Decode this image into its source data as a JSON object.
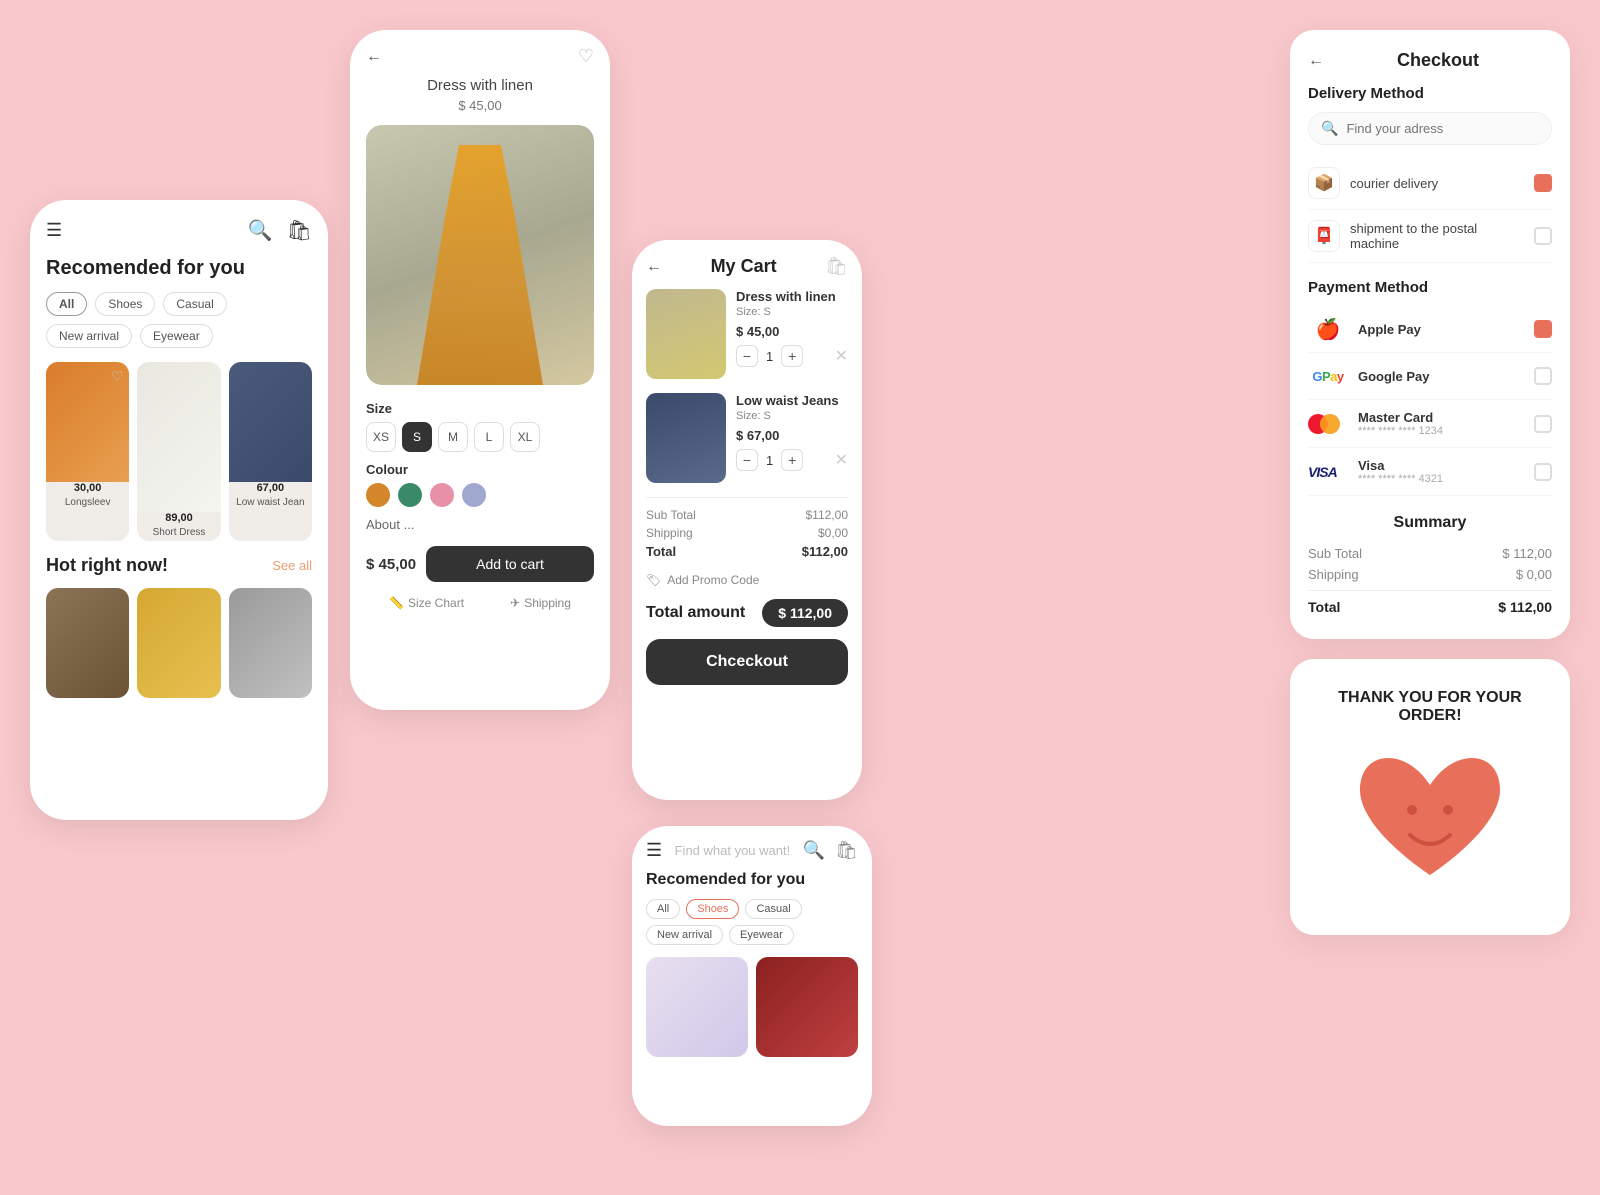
{
  "phone1": {
    "title": "Recomended for you",
    "filters": [
      "All",
      "Shoes",
      "Casual",
      "New arrival",
      "Eyewear"
    ],
    "active_filter": "All",
    "products": [
      {
        "name": "Longsleev",
        "price": "30,00"
      },
      {
        "name": "Short Dress",
        "price": "89,00"
      },
      {
        "name": "Low waist Jeans",
        "price": "67,00"
      }
    ],
    "hot_title": "Hot right now!",
    "see_all": "See all"
  },
  "phone2": {
    "title": "Dress with linen",
    "price": "$ 45,00",
    "sizes": [
      "XS",
      "S",
      "M",
      "L",
      "XL"
    ],
    "active_size": "S",
    "colours": [
      "#d4862a",
      "#3a8a6a",
      "#e890a8",
      "#a0a8d0"
    ],
    "about_label": "About ...",
    "cart_price": "$ 45,00",
    "add_to_cart": "Add to cart",
    "size_chart": "Size Chart",
    "shipping": "Shipping"
  },
  "phone3": {
    "title": "My Cart",
    "items": [
      {
        "name": "Dress with linen",
        "size": "Size: S",
        "price": "$ 45,00",
        "qty": 1
      },
      {
        "name": "Low waist Jeans",
        "size": "Size: S",
        "price": "$ 67,00",
        "qty": 1
      }
    ],
    "sub_total_label": "Sub Total",
    "sub_total": "$112,00",
    "shipping_label": "Shipping",
    "shipping": "$0,00",
    "total_label": "Total",
    "total": "$112,00",
    "promo_label": "Add Promo Code",
    "total_amount_label": "Total amount",
    "total_amount": "$ 112,00",
    "checkout_btn": "Chceckout"
  },
  "phone4": {
    "search_placeholder": "Find what you want!",
    "title": "Recomended for you",
    "filters": [
      "All",
      "Shoes",
      "Casual",
      "New arrival",
      "Eyewear"
    ],
    "active_filter": "Shoes"
  },
  "checkout": {
    "back_icon": "←",
    "title": "Checkout",
    "delivery_title": "Delivery Method",
    "address_placeholder": "Find your adress",
    "delivery_options": [
      {
        "label": "courier delivery",
        "checked": true
      },
      {
        "label": "shipment to the postal machine",
        "checked": false
      }
    ],
    "payment_title": "Payment Method",
    "payment_options": [
      {
        "name": "Apple Pay",
        "type": "apple_pay",
        "checked": true
      },
      {
        "name": "Google Pay",
        "type": "google_pay",
        "checked": false
      },
      {
        "name": "Master Card",
        "detail": "**** **** **** 1234",
        "type": "mastercard",
        "checked": false
      },
      {
        "name": "Visa",
        "detail": "**** **** **** 4321",
        "type": "visa",
        "checked": false
      }
    ],
    "summary_title": "Summary",
    "sub_total_label": "Sub Total",
    "sub_total": "$ 112,00",
    "shipping_label": "Shipping",
    "shipping": "$ 0,00",
    "total_label": "Total",
    "total": "$ 112,00"
  },
  "thankyou": {
    "text": "THANK YOU FOR YOUR ORDER!"
  }
}
